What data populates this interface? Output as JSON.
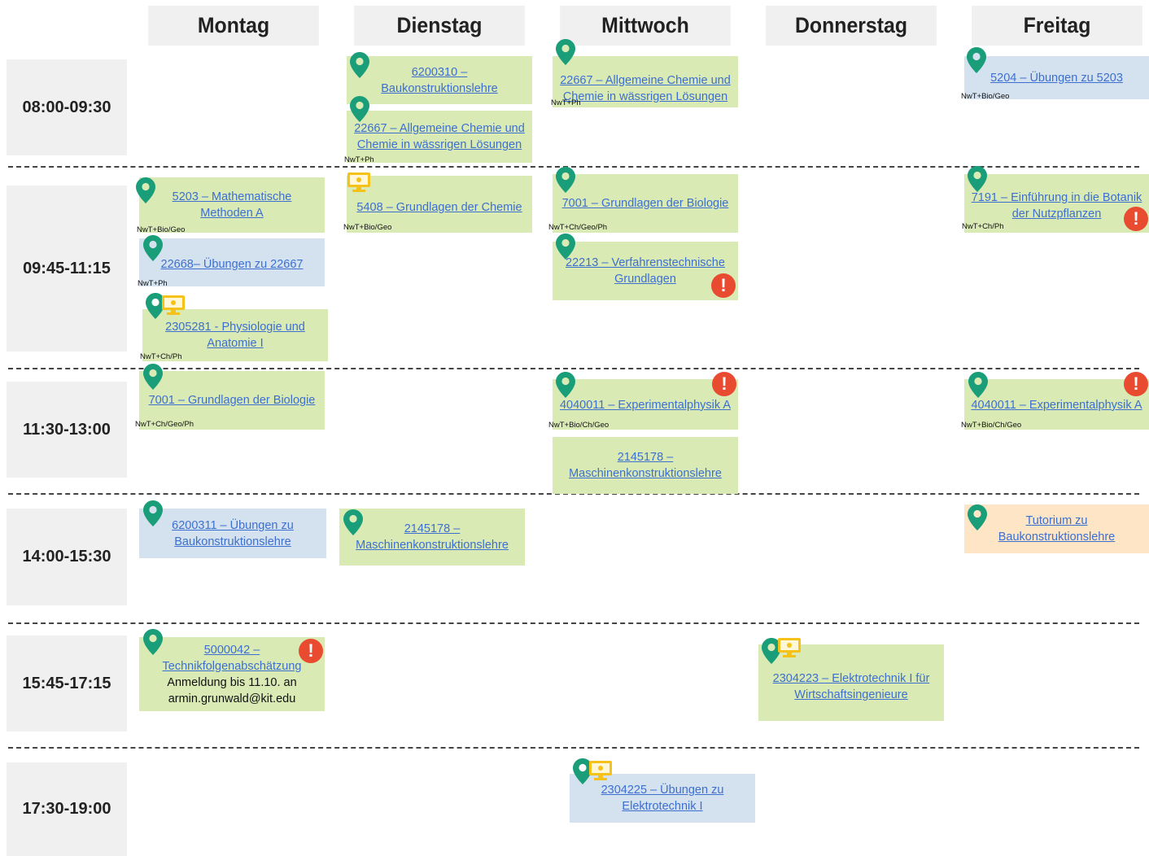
{
  "days": [
    "Montag",
    "Dienstag",
    "Mittwoch",
    "Donnerstag",
    "Freitag"
  ],
  "times": [
    "08:00-09:30",
    "09:45-11:15",
    "11:30-13:00",
    "14:00-15:30",
    "15:45-17:15",
    "17:30-19:00"
  ],
  "courses": [
    {
      "id": "c1",
      "title": "6200310 – Baukonstruktionslehre",
      "color": "green"
    },
    {
      "id": "c2",
      "title": "22667 – Allgemeine Chemie und Chemie in wässrigen Lösungen",
      "tag": "NwT+Ph",
      "color": "green"
    },
    {
      "id": "c3",
      "title": "22667 – Allgemeine Chemie und Chemie in wässrigen Lösungen",
      "tag": "NwT+Ph",
      "color": "green"
    },
    {
      "id": "c4",
      "title": "5204 – Übungen zu 5203",
      "tag": "NwT+Bio/Geo",
      "color": "blue"
    },
    {
      "id": "c5",
      "title": "5203 – Mathematische Methoden A",
      "tag": "NwT+Bio/Geo",
      "color": "green"
    },
    {
      "id": "c6",
      "title": "5408 – Grundlagen der Chemie",
      "tag": "NwT+Bio/Geo",
      "color": "green"
    },
    {
      "id": "c7",
      "title": "7001 – Grundlagen der Biologie",
      "tag": "NwT+Ch/Geo/Ph",
      "color": "green"
    },
    {
      "id": "c8",
      "title": "7191 – Einführung in die Botanik der Nutzpflanzen",
      "tag": "NwT+Ch/Ph",
      "color": "green"
    },
    {
      "id": "c9",
      "title": "22668– Übungen zu 22667",
      "tag": "NwT+Ph",
      "color": "blue"
    },
    {
      "id": "c10",
      "title": "22213 – Verfahrenstechnische Grundlagen",
      "color": "green"
    },
    {
      "id": "c11",
      "title": "2305281 - Physiologie und Anatomie I",
      "tag": "NwT+Ch/Ph",
      "color": "green"
    },
    {
      "id": "c12",
      "title": "7001 – Grundlagen der Biologie",
      "tag": "NwT+Ch/Geo/Ph",
      "color": "green"
    },
    {
      "id": "c13",
      "title": "4040011 – Experimentalphysik A",
      "tag": "NwT+Bio/Ch/Geo",
      "color": "green"
    },
    {
      "id": "c14",
      "title": "4040011 – Experimentalphysik A",
      "tag": "NwT+Bio/Ch/Geo",
      "color": "green"
    },
    {
      "id": "c15",
      "title": "2145178 – Maschinenkonstruktionslehre",
      "color": "green"
    },
    {
      "id": "c16",
      "title": "6200311 – Übungen zu Baukonstruktionslehre",
      "color": "blue"
    },
    {
      "id": "c17",
      "title": "2145178 – Maschinenkonstruktionslehre",
      "color": "green"
    },
    {
      "id": "c18",
      "title": "Tutorium zu Baukonstruktionslehre",
      "color": "orange"
    },
    {
      "id": "c19",
      "title": "5000042 – Technikfolgenabschätzung",
      "note": "Anmeldung bis 11.10. an armin.grunwald@kit.edu",
      "color": "green"
    },
    {
      "id": "c20",
      "title": "2304223 – Elektrotechnik I für Wirtschaftsingenieure",
      "color": "green"
    },
    {
      "id": "c21",
      "title": "2304225 – Übungen zu Elektrotechnik I",
      "color": "blue"
    }
  ],
  "icons": {
    "pin": "map-pin-icon",
    "warn": "warning-icon",
    "screen": "online-screen-icon"
  }
}
